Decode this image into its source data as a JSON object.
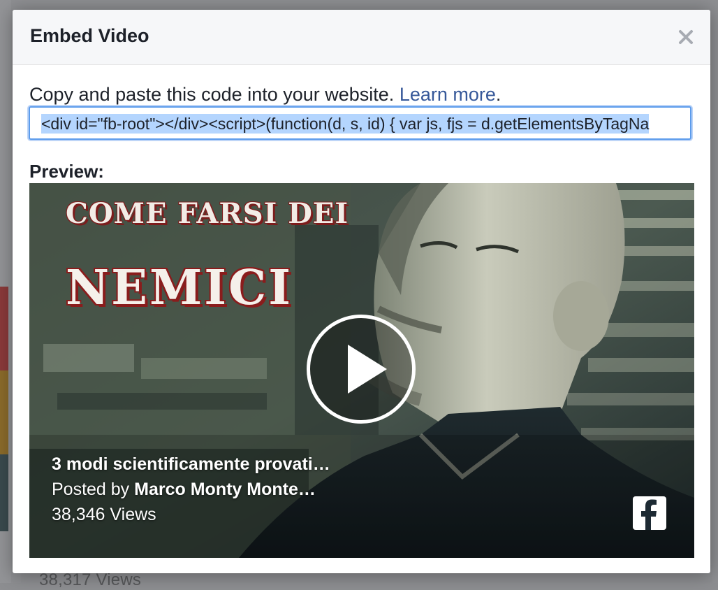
{
  "dialog": {
    "title": "Embed Video",
    "close_icon": "close-icon"
  },
  "instructions": {
    "text": "Copy and paste this code into your website.",
    "learn_more": "Learn more",
    "period": "."
  },
  "embed_code": {
    "value": "<div id=\"fb-root\"></div><script>(function(d, s, id) {  var js, fjs = d.getElementsByTagNa"
  },
  "preview": {
    "label": "Preview:",
    "thumbnail_line1": "COME FARSI DEI",
    "thumbnail_line2": "NEMICI",
    "video_title": "3 modi scientificamente provati…",
    "posted_by_prefix": "Posted by",
    "author": "Marco Monty Monte…",
    "views": "38,346 Views",
    "play_icon": "play-icon",
    "brand_icon": "facebook-logo-icon"
  },
  "background": {
    "views_text": "38,317 Views"
  },
  "colors": {
    "link": "#365899",
    "focus_border": "#5d9cec",
    "selection": "#b4d5fe",
    "title_red": "#8a1c1c"
  }
}
